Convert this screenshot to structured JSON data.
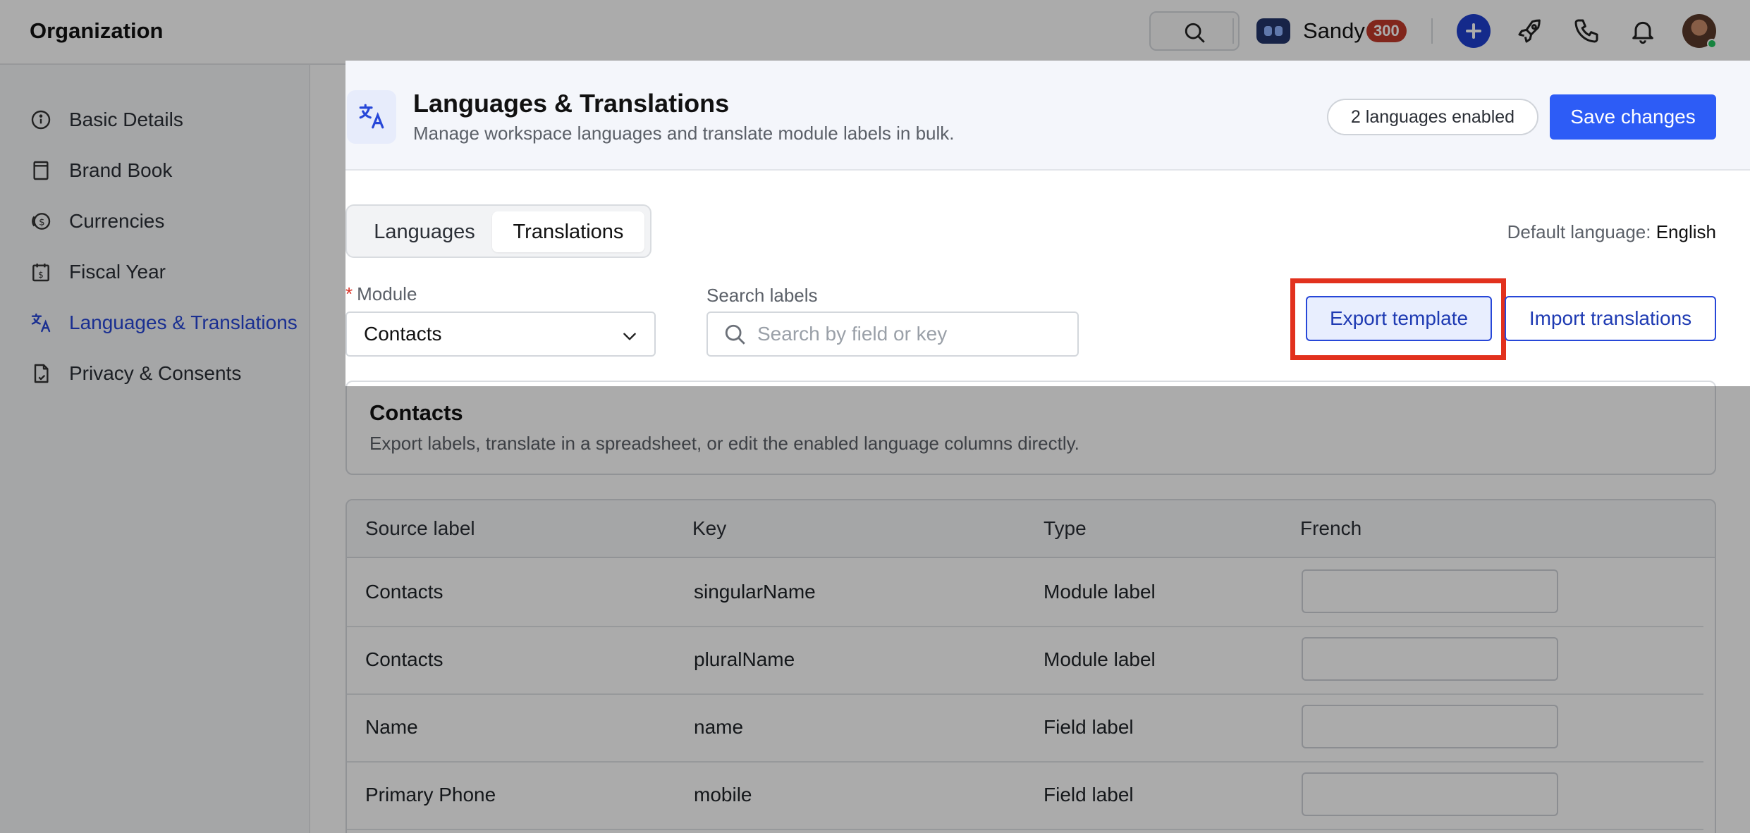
{
  "topbar": {
    "title": "Organization",
    "user_name": "Sandy",
    "credits": "300",
    "icons": [
      "search-icon",
      "bot-icon",
      "plus-icon",
      "rocket-icon",
      "phone-icon",
      "bell-icon",
      "avatar"
    ]
  },
  "sidebar": {
    "items": [
      {
        "label": "Basic Details",
        "icon": "info-icon"
      },
      {
        "label": "Brand Book",
        "icon": "book-icon"
      },
      {
        "label": "Currencies",
        "icon": "currency-icon"
      },
      {
        "label": "Fiscal Year",
        "icon": "calendar-icon"
      },
      {
        "label": "Languages & Translations",
        "icon": "translate-icon",
        "active": true
      },
      {
        "label": "Privacy & Consents",
        "icon": "document-check-icon"
      }
    ]
  },
  "header": {
    "title": "Languages & Translations",
    "subtitle": "Manage workspace languages and translate module labels in bulk.",
    "languages_badge": "2 languages enabled",
    "save_label": "Save changes"
  },
  "tabs": {
    "items": [
      "Languages",
      "Translations"
    ],
    "selected": "Translations"
  },
  "default_language": {
    "label": "Default language:",
    "value": "English"
  },
  "filters": {
    "module_label": "Module",
    "module_value": "Contacts",
    "search_label": "Search labels",
    "search_placeholder": "Search by field or key"
  },
  "actions": {
    "export_label": "Export template",
    "import_label": "Import translations"
  },
  "section": {
    "title": "Contacts",
    "subtitle": "Export labels, translate in a spreadsheet, or edit the enabled language columns directly."
  },
  "table": {
    "headers": [
      "Source label",
      "Key",
      "Type",
      "French"
    ],
    "rows": [
      {
        "source": "Contacts",
        "key": "singularName",
        "type": "Module label",
        "french": ""
      },
      {
        "source": "Contacts",
        "key": "pluralName",
        "type": "Module label",
        "french": ""
      },
      {
        "source": "Name",
        "key": "name",
        "type": "Field label",
        "french": ""
      },
      {
        "source": "Primary Phone",
        "key": "mobile",
        "type": "Field label",
        "french": ""
      }
    ]
  },
  "colors": {
    "accent": "#2d5cf6",
    "active_nav": "#2747d8",
    "highlight_box": "#e2311d",
    "badge": "#c0392b"
  }
}
